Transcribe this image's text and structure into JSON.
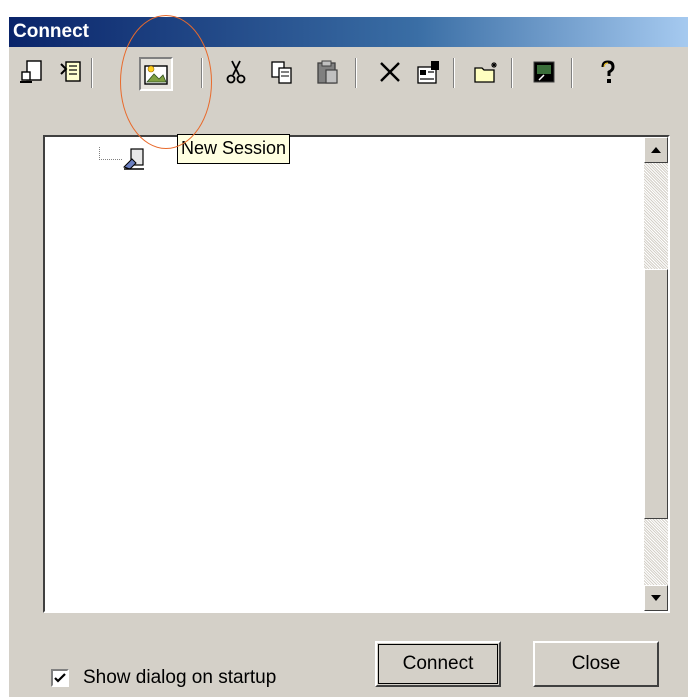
{
  "window": {
    "title": "Connect"
  },
  "toolbar": {
    "buttons": [
      {
        "name": "connect-session-icon"
      },
      {
        "name": "quick-connect-icon"
      },
      {
        "name": "new-session-icon",
        "active": true
      },
      {
        "name": "cut-icon"
      },
      {
        "name": "copy-icon"
      },
      {
        "name": "paste-icon"
      },
      {
        "name": "delete-icon"
      },
      {
        "name": "properties-icon"
      },
      {
        "name": "new-folder-icon"
      },
      {
        "name": "terminal-shortcut-icon"
      },
      {
        "name": "help-icon"
      }
    ],
    "tooltip": "New Session"
  },
  "tree": {
    "items": [
      {
        "label": "",
        "icon": "session-icon"
      }
    ]
  },
  "footer": {
    "show_dialog_label": "Show dialog on startup",
    "show_dialog_checked": true,
    "connect_label": "Connect",
    "close_label": "Close"
  },
  "colors": {
    "title_start": "#0a246a",
    "title_end": "#a6caf0",
    "face": "#d4d0c8",
    "tooltip_bg": "#ffffe1",
    "highlight_ring": "#e86a2c"
  }
}
